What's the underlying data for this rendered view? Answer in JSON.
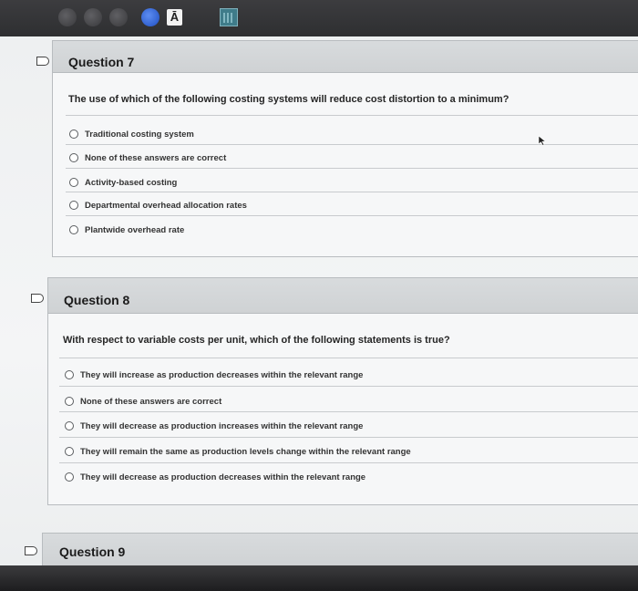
{
  "topbar": {
    "a_icon_label": "Ā",
    "icons": [
      "app-icon",
      "app-icon",
      "app-icon",
      "blue-app-icon",
      "text-a-icon",
      "calculator-icon"
    ]
  },
  "questions": [
    {
      "title": "Question 7",
      "prompt": "The use of which of the following costing systems will reduce cost distortion to a minimum?",
      "options": [
        "Traditional costing system",
        "None of these answers are correct",
        "Activity-based costing",
        "Departmental overhead allocation rates",
        "Plantwide overhead rate"
      ]
    },
    {
      "title": "Question 8",
      "prompt": "With respect to variable costs per unit, which of the following statements is true?",
      "options": [
        "They will increase as production decreases within the relevant range",
        "None of these answers are correct",
        "They will decrease as production increases within the relevant range",
        "They will remain the same as production levels change within the relevant range",
        "They will decrease as production decreases within the relevant range"
      ]
    },
    {
      "title": "Question 9",
      "prompt": "",
      "options": []
    }
  ],
  "colors": {
    "header_bg": "#d3d6d8",
    "page_bg": "#f1f2f3",
    "topbar_bg": "#333436",
    "dock_blue": "#2f63d6"
  }
}
